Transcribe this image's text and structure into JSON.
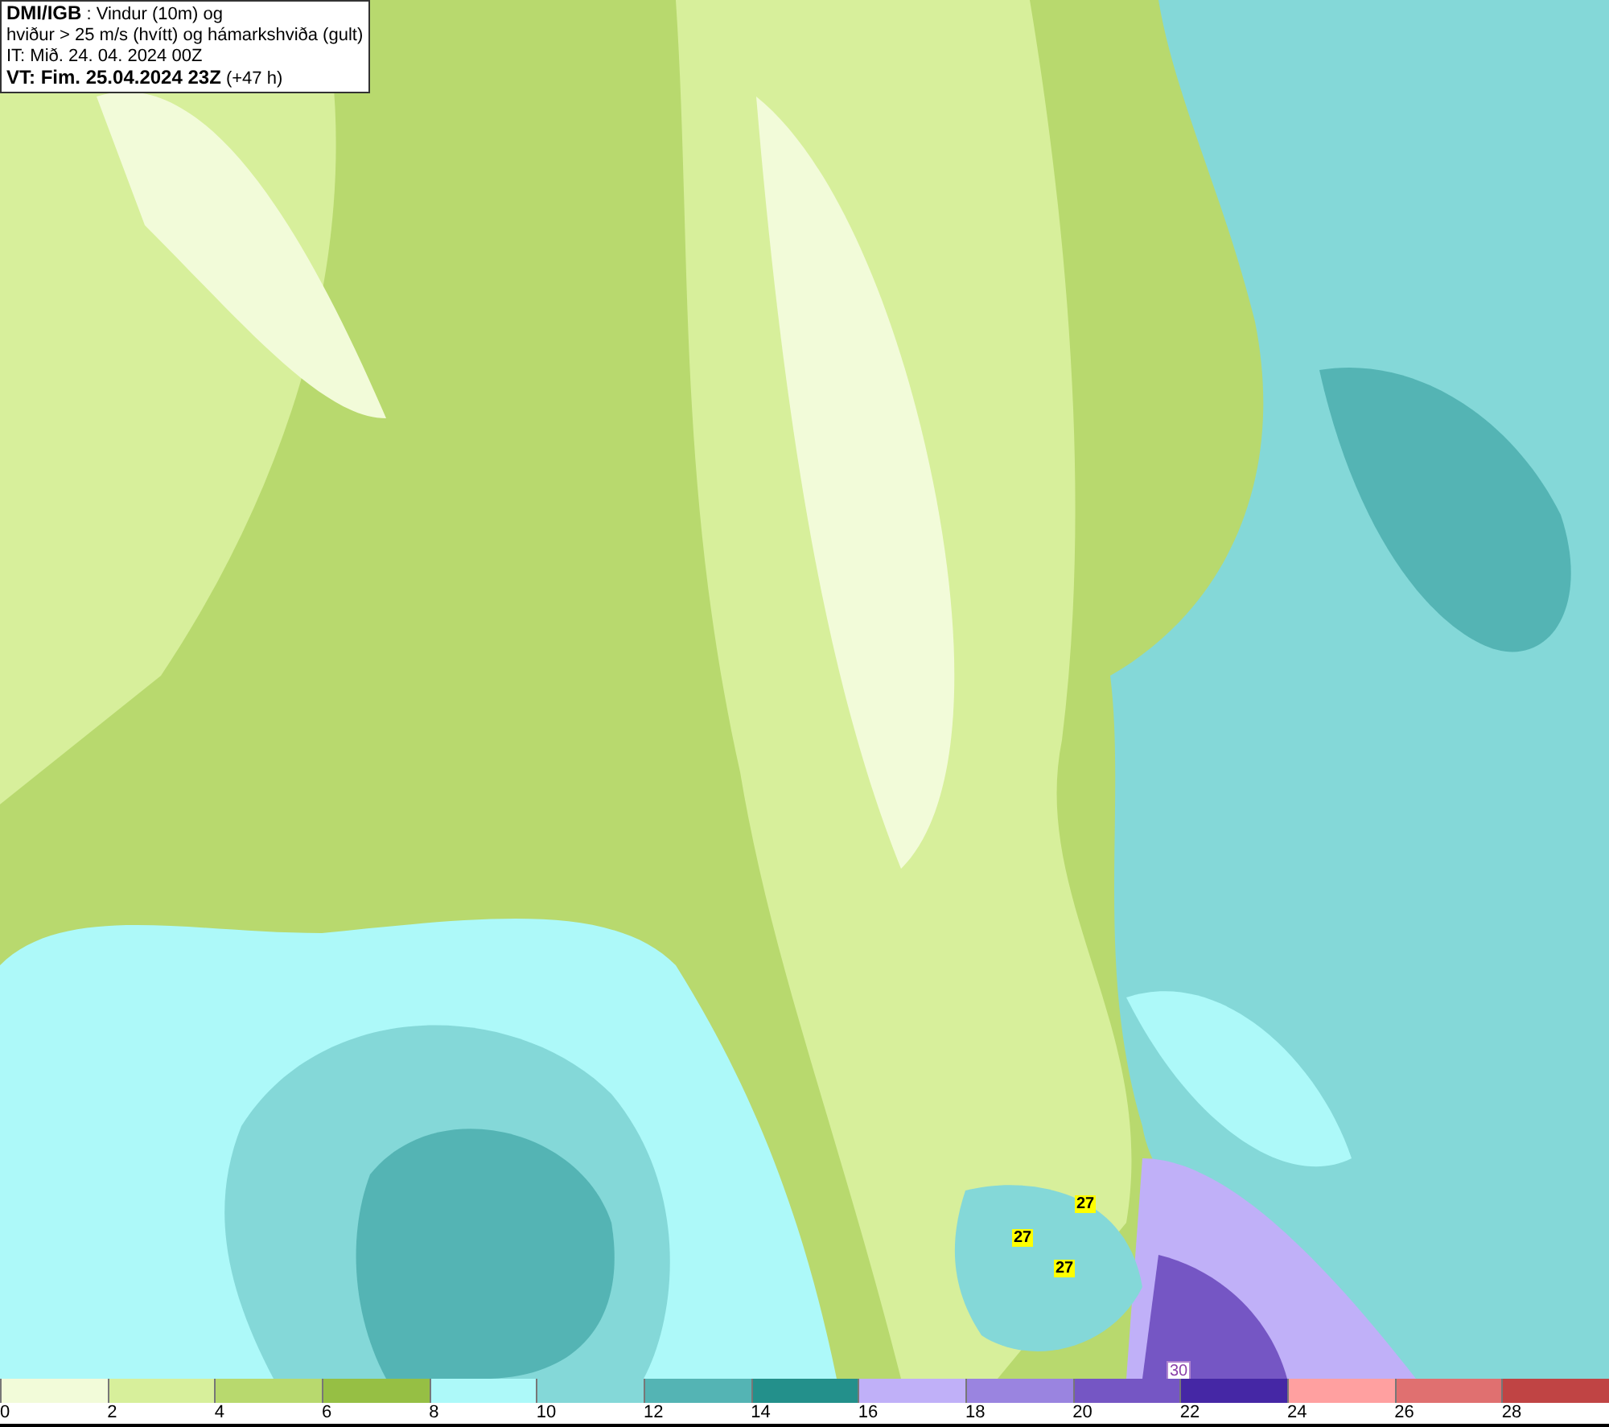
{
  "header": {
    "lines": [
      "**DMI/IGB** : Vindur (10m) og",
      "hviður > 25 m/s (hvítt) og hámarkshviða (gult)",
      "IT: Mið. 24. 04. 2024 00Z",
      "**VT: Fim. 25.04.2024 23Z** (+47 h)"
    ]
  },
  "map": {
    "gust_labels": [
      {
        "text": "27",
        "kind": "max"
      },
      {
        "text": "27",
        "kind": "max"
      },
      {
        "text": "27",
        "kind": "max"
      },
      {
        "text": "30",
        "kind": "gust"
      }
    ]
  },
  "legend": [
    {
      "label": "0",
      "color": "#f2fbd9"
    },
    {
      "label": "2",
      "color": "#d7ef9b"
    },
    {
      "label": "4",
      "color": "#b8d96e"
    },
    {
      "label": "6",
      "color": "#96bf44"
    },
    {
      "label": "8",
      "color": "#adf9f9"
    },
    {
      "label": "10",
      "color": "#84d8d8"
    },
    {
      "label": "12",
      "color": "#54b4b4"
    },
    {
      "label": "14",
      "color": "#23908b"
    },
    {
      "label": "16",
      "color": "#c0b0f8"
    },
    {
      "label": "18",
      "color": "#9a84e0"
    },
    {
      "label": "20",
      "color": "#7556c4"
    },
    {
      "label": "22",
      "color": "#4527a5"
    },
    {
      "label": "24",
      "color": "#ffa0a0"
    },
    {
      "label": "26",
      "color": "#e07070"
    },
    {
      "label": "28",
      "color": "#c04444"
    }
  ]
}
